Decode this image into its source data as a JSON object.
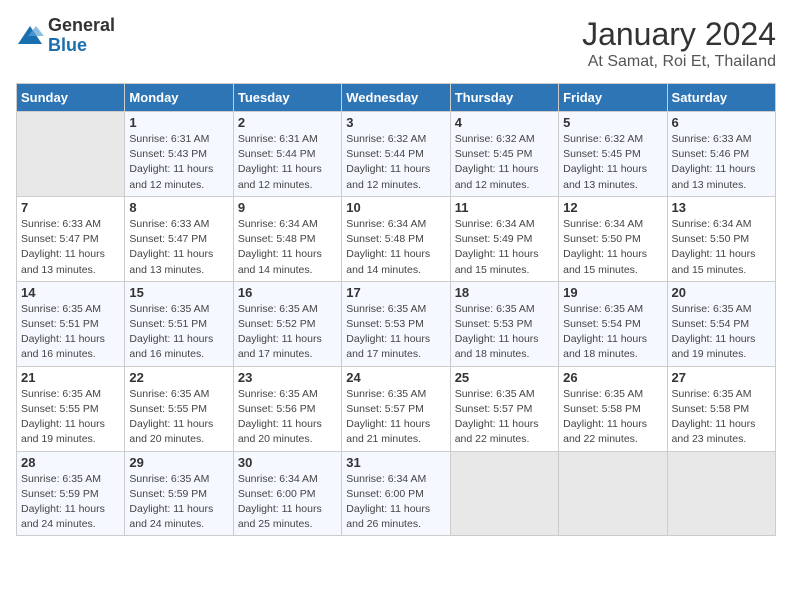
{
  "logo": {
    "general": "General",
    "blue": "Blue"
  },
  "title": "January 2024",
  "subtitle": "At Samat, Roi Et, Thailand",
  "weekdays": [
    "Sunday",
    "Monday",
    "Tuesday",
    "Wednesday",
    "Thursday",
    "Friday",
    "Saturday"
  ],
  "weeks": [
    [
      {
        "day": null
      },
      {
        "day": "1",
        "sunrise": "6:31 AM",
        "sunset": "5:43 PM",
        "daylight": "11 hours and 12 minutes."
      },
      {
        "day": "2",
        "sunrise": "6:31 AM",
        "sunset": "5:44 PM",
        "daylight": "11 hours and 12 minutes."
      },
      {
        "day": "3",
        "sunrise": "6:32 AM",
        "sunset": "5:44 PM",
        "daylight": "11 hours and 12 minutes."
      },
      {
        "day": "4",
        "sunrise": "6:32 AM",
        "sunset": "5:45 PM",
        "daylight": "11 hours and 12 minutes."
      },
      {
        "day": "5",
        "sunrise": "6:32 AM",
        "sunset": "5:45 PM",
        "daylight": "11 hours and 13 minutes."
      },
      {
        "day": "6",
        "sunrise": "6:33 AM",
        "sunset": "5:46 PM",
        "daylight": "11 hours and 13 minutes."
      }
    ],
    [
      {
        "day": "7",
        "sunrise": "6:33 AM",
        "sunset": "5:47 PM",
        "daylight": "11 hours and 13 minutes."
      },
      {
        "day": "8",
        "sunrise": "6:33 AM",
        "sunset": "5:47 PM",
        "daylight": "11 hours and 13 minutes."
      },
      {
        "day": "9",
        "sunrise": "6:34 AM",
        "sunset": "5:48 PM",
        "daylight": "11 hours and 14 minutes."
      },
      {
        "day": "10",
        "sunrise": "6:34 AM",
        "sunset": "5:48 PM",
        "daylight": "11 hours and 14 minutes."
      },
      {
        "day": "11",
        "sunrise": "6:34 AM",
        "sunset": "5:49 PM",
        "daylight": "11 hours and 15 minutes."
      },
      {
        "day": "12",
        "sunrise": "6:34 AM",
        "sunset": "5:50 PM",
        "daylight": "11 hours and 15 minutes."
      },
      {
        "day": "13",
        "sunrise": "6:34 AM",
        "sunset": "5:50 PM",
        "daylight": "11 hours and 15 minutes."
      }
    ],
    [
      {
        "day": "14",
        "sunrise": "6:35 AM",
        "sunset": "5:51 PM",
        "daylight": "11 hours and 16 minutes."
      },
      {
        "day": "15",
        "sunrise": "6:35 AM",
        "sunset": "5:51 PM",
        "daylight": "11 hours and 16 minutes."
      },
      {
        "day": "16",
        "sunrise": "6:35 AM",
        "sunset": "5:52 PM",
        "daylight": "11 hours and 17 minutes."
      },
      {
        "day": "17",
        "sunrise": "6:35 AM",
        "sunset": "5:53 PM",
        "daylight": "11 hours and 17 minutes."
      },
      {
        "day": "18",
        "sunrise": "6:35 AM",
        "sunset": "5:53 PM",
        "daylight": "11 hours and 18 minutes."
      },
      {
        "day": "19",
        "sunrise": "6:35 AM",
        "sunset": "5:54 PM",
        "daylight": "11 hours and 18 minutes."
      },
      {
        "day": "20",
        "sunrise": "6:35 AM",
        "sunset": "5:54 PM",
        "daylight": "11 hours and 19 minutes."
      }
    ],
    [
      {
        "day": "21",
        "sunrise": "6:35 AM",
        "sunset": "5:55 PM",
        "daylight": "11 hours and 19 minutes."
      },
      {
        "day": "22",
        "sunrise": "6:35 AM",
        "sunset": "5:55 PM",
        "daylight": "11 hours and 20 minutes."
      },
      {
        "day": "23",
        "sunrise": "6:35 AM",
        "sunset": "5:56 PM",
        "daylight": "11 hours and 20 minutes."
      },
      {
        "day": "24",
        "sunrise": "6:35 AM",
        "sunset": "5:57 PM",
        "daylight": "11 hours and 21 minutes."
      },
      {
        "day": "25",
        "sunrise": "6:35 AM",
        "sunset": "5:57 PM",
        "daylight": "11 hours and 22 minutes."
      },
      {
        "day": "26",
        "sunrise": "6:35 AM",
        "sunset": "5:58 PM",
        "daylight": "11 hours and 22 minutes."
      },
      {
        "day": "27",
        "sunrise": "6:35 AM",
        "sunset": "5:58 PM",
        "daylight": "11 hours and 23 minutes."
      }
    ],
    [
      {
        "day": "28",
        "sunrise": "6:35 AM",
        "sunset": "5:59 PM",
        "daylight": "11 hours and 24 minutes."
      },
      {
        "day": "29",
        "sunrise": "6:35 AM",
        "sunset": "5:59 PM",
        "daylight": "11 hours and 24 minutes."
      },
      {
        "day": "30",
        "sunrise": "6:34 AM",
        "sunset": "6:00 PM",
        "daylight": "11 hours and 25 minutes."
      },
      {
        "day": "31",
        "sunrise": "6:34 AM",
        "sunset": "6:00 PM",
        "daylight": "11 hours and 26 minutes."
      },
      {
        "day": null
      },
      {
        "day": null
      },
      {
        "day": null
      }
    ]
  ],
  "labels": {
    "sunrise": "Sunrise:",
    "sunset": "Sunset:",
    "daylight": "Daylight:"
  }
}
